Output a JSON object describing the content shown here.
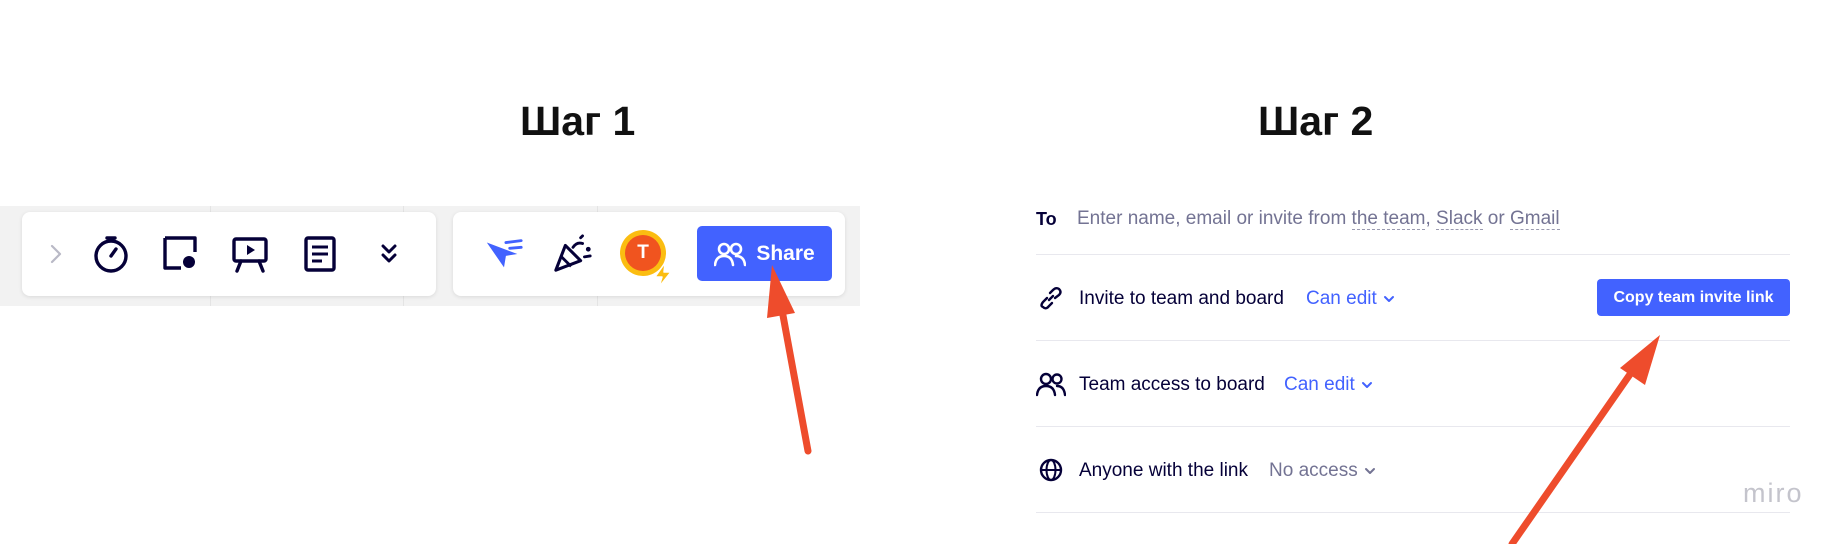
{
  "steps": {
    "step1_title": "Шаг 1",
    "step2_title": "Шаг 2"
  },
  "toolbar": {
    "icons": [
      "chevron-right-icon",
      "timer-icon",
      "card-icon",
      "presentation-icon",
      "notes-icon",
      "more-chevrons-icon",
      "cursor-icon",
      "reaction-icon"
    ],
    "avatar_initial": "T",
    "share_label": "Share"
  },
  "share_panel": {
    "to_label": "To",
    "to_placeholder_prefix": "Enter name, email or invite from ",
    "to_link_team": "the team",
    "to_sep1": ", ",
    "to_link_slack": "Slack",
    "to_sep2": " or ",
    "to_link_gmail": "Gmail",
    "rows": [
      {
        "label": "Invite to team and board",
        "permission": "Can edit"
      },
      {
        "label": "Team access to board",
        "permission": "Can edit"
      },
      {
        "label": "Anyone with the link",
        "permission": "No access"
      }
    ],
    "copy_button": "Copy team invite link"
  },
  "brand": {
    "logo_text": "miro",
    "accent": "#4262ff",
    "arrow": "#ee4c2c"
  }
}
